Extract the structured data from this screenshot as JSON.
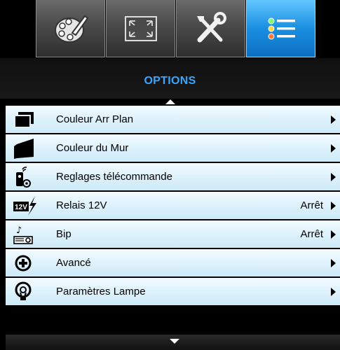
{
  "tabs": [
    {
      "name": "picture-icon",
      "active": false
    },
    {
      "name": "screen-icon",
      "active": false
    },
    {
      "name": "setup-icon",
      "active": false
    },
    {
      "name": "options-icon",
      "active": true
    }
  ],
  "header": {
    "title": "OPTIONS"
  },
  "menu": {
    "items": [
      {
        "label": "Couleur Arr Plan",
        "value": "",
        "icon": "background-color-icon"
      },
      {
        "label": "Couleur du Mur",
        "value": "",
        "icon": "wall-color-icon"
      },
      {
        "label": "Reglages télécommande",
        "value": "",
        "icon": "remote-settings-icon"
      },
      {
        "label": "Relais 12V",
        "value": "Arrêt",
        "icon": "relay-12v-icon"
      },
      {
        "label": "Bip",
        "value": "Arrêt",
        "icon": "beep-icon"
      },
      {
        "label": "Avancé",
        "value": "",
        "icon": "advanced-icon"
      },
      {
        "label": "Paramètres Lampe",
        "value": "",
        "icon": "lamp-settings-icon"
      }
    ]
  },
  "colors": {
    "accent": "#3aa6ff",
    "row": "#dcf1fb",
    "active_tab": "#1a8fe0"
  }
}
